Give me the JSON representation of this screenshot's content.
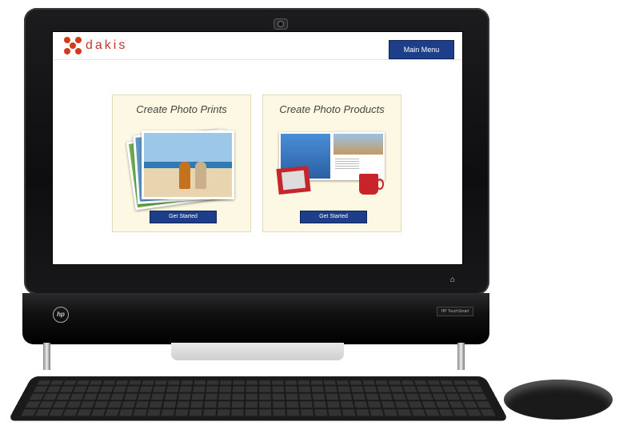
{
  "app": {
    "logo_text": "dakis",
    "main_menu_label": "Main Menu"
  },
  "cards": [
    {
      "title": "Create Photo Prints",
      "button_label": "Get Started"
    },
    {
      "title": "Create Photo Products",
      "button_label": "Get Started"
    }
  ],
  "device": {
    "badge_label": "HP TouchSmart",
    "brand_mark": "hp"
  },
  "colors": {
    "accent": "#1d3f8a",
    "logo": "#c0392b",
    "card_bg": "#fcf8e3"
  }
}
